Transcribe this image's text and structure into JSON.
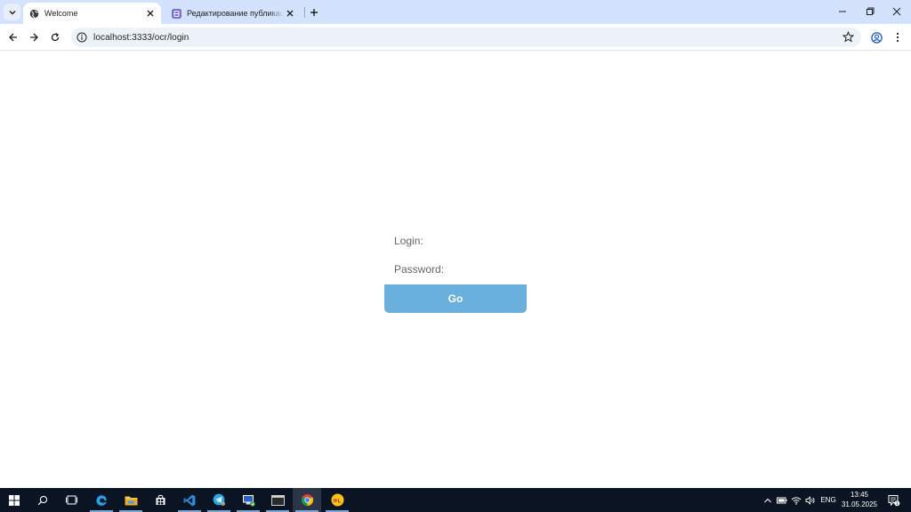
{
  "browser": {
    "tabs": [
      {
        "title": "Welcome",
        "active": true,
        "favicon": "globe-icon"
      },
      {
        "title": "Редактирование публикации",
        "active": false,
        "favicon": "app-icon"
      }
    ],
    "address": "localhost:3333/ocr/login"
  },
  "login_form": {
    "login_label": "Login:",
    "password_label": "Password:",
    "submit_label": "Go",
    "button_color": "#6ab0dd"
  },
  "taskbar": {
    "apps": [
      "start-icon",
      "search-icon",
      "task-view-icon",
      "edge-icon",
      "file-explorer-icon",
      "store-icon",
      "vscode-icon",
      "telegram-icon",
      "remote-desktop-icon",
      "terminal-icon",
      "chrome-icon",
      "app-icon"
    ],
    "language": "ENG",
    "time": "13:45",
    "date": "31.05.2025",
    "notification_count": "1"
  }
}
